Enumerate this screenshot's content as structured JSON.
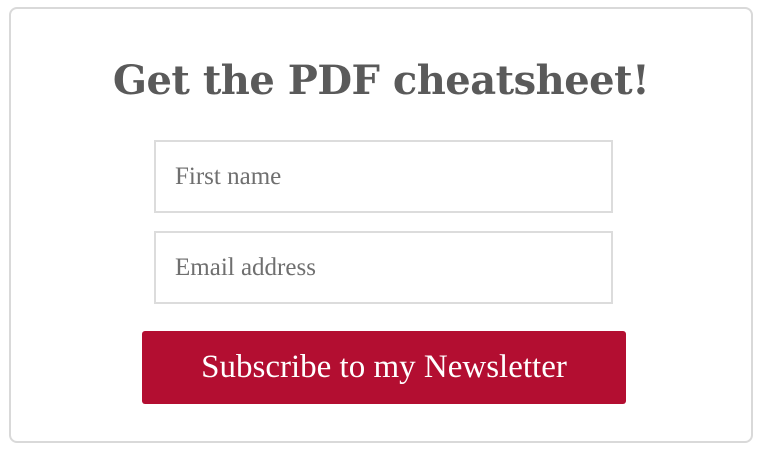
{
  "signup": {
    "title": "Get the PDF cheatsheet!",
    "first_name": {
      "value": "",
      "placeholder": "First name"
    },
    "email": {
      "value": "",
      "placeholder": "Email address"
    },
    "submit_label": "Subscribe to my Newsletter"
  },
  "colors": {
    "button_bg": "#b30e31",
    "button_text": "#ffffff",
    "title_text": "#5a5a5a",
    "border": "#d9d9d9"
  }
}
